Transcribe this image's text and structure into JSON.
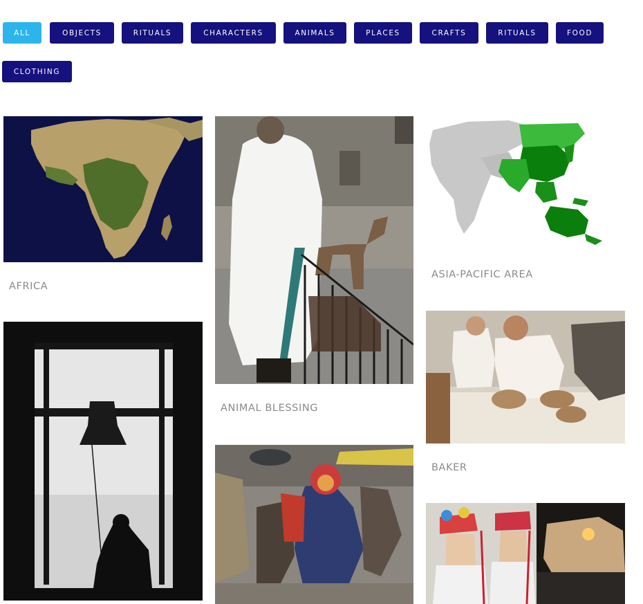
{
  "filters": {
    "items": [
      {
        "label": "ALL",
        "active": true
      },
      {
        "label": "OBJECTS"
      },
      {
        "label": "RITUALS"
      },
      {
        "label": "CHARACTERS"
      },
      {
        "label": "ANIMALS"
      },
      {
        "label": "PLACES"
      },
      {
        "label": "CRAFTS"
      },
      {
        "label": "RITUALS"
      },
      {
        "label": "FOOD"
      },
      {
        "label": "CLOTHING"
      }
    ]
  },
  "gallery": {
    "items": [
      {
        "title": "AFRICA",
        "image": "africa-satellite-map"
      },
      {
        "title": "ANIMAL BLESSING",
        "image": "priest-blessing-horse-photo"
      },
      {
        "title": "ASIA-PACIFIC AREA",
        "image": "asia-pacific-highlight-map"
      },
      {
        "title": "",
        "image": "bell-tower-silhouette-photo"
      },
      {
        "title": "BAKER",
        "image": "bakers-kneading-dough-photo"
      },
      {
        "title": "",
        "image": "carnival-masked-characters-photo"
      },
      {
        "title": "",
        "image": "ribbon-hat-dancers-photo"
      }
    ]
  },
  "colors": {
    "button": "#15117e",
    "button_active": "#2bb5ec",
    "caption": "#8a8a8a",
    "map_green": "#1a8f1a",
    "map_gray": "#c8c8c8"
  }
}
